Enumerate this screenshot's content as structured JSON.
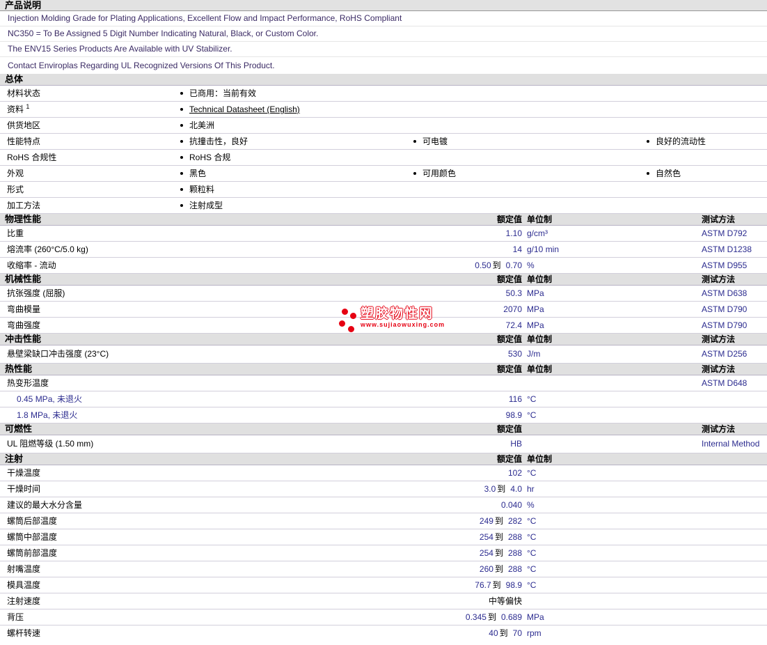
{
  "colors": {
    "value_text": "#2b2b8f",
    "description_text": "#3a2a64",
    "link": "#0000cc",
    "watermark_red": "#e60012",
    "section_bar_bg": "#e0e0e0"
  },
  "header": {
    "title": "产品说明"
  },
  "description": {
    "lines": [
      "Injection Molding Grade for Plating Applications, Excellent Flow and Impact Performance, RoHS Compliant",
      "NC350 = To Be Assigned 5 Digit Number Indicating Natural, Black, or Custom Color.",
      "The ENV15 Series Products Are Available with UV Stabilizer.",
      "Contact Enviroplas Regarding UL Recognized Versions Of This Product."
    ]
  },
  "general": {
    "title": "总体",
    "rows": [
      {
        "label": "材料状态",
        "items": [
          "已商用：当前有效"
        ]
      },
      {
        "label": "资料",
        "sup": "1",
        "items": [
          "Technical Datasheet (English)"
        ]
      },
      {
        "label": "供货地区",
        "items": [
          "北美洲"
        ]
      },
      {
        "label": "性能特点",
        "items": [
          "抗撞击性，良好",
          "可电镀",
          "良好的流动性"
        ]
      },
      {
        "label": "RoHS 合规性",
        "items": [
          "RoHS 合规"
        ]
      },
      {
        "label": "外观",
        "items": [
          "黑色",
          "可用颜色",
          "自然色"
        ]
      },
      {
        "label": "形式",
        "items": [
          "颗粒料"
        ]
      },
      {
        "label": "加工方法",
        "items": [
          "注射成型"
        ]
      }
    ]
  },
  "sections": [
    {
      "title": "物理性能",
      "col_value": "额定值",
      "col_unit": "单位制",
      "col_method": "测试方法",
      "rows": [
        {
          "label": "比重",
          "v1": "1.10",
          "unit": "g/cm³",
          "method": "ASTM D792"
        },
        {
          "label": "熔流率 (260°C/5.0 kg)",
          "v1": "14",
          "unit": "g/10 min",
          "method": "ASTM D1238"
        },
        {
          "label": "收缩率 - 流动",
          "v1": "0.50",
          "to": "到",
          "v2": "0.70",
          "unit": "%",
          "method": "ASTM D955"
        }
      ]
    },
    {
      "title": "机械性能",
      "col_value": "额定值",
      "col_unit": "单位制",
      "col_method": "测试方法",
      "rows": [
        {
          "label": "抗张强度 (屈服)",
          "v1": "50.3",
          "unit": "MPa",
          "method": "ASTM D638"
        },
        {
          "label": "弯曲模量",
          "v1": "2070",
          "unit": "MPa",
          "method": "ASTM D790"
        },
        {
          "label": "弯曲强度",
          "v1": "72.4",
          "unit": "MPa",
          "method": "ASTM D790"
        }
      ]
    },
    {
      "title": "冲击性能",
      "col_value": "额定值",
      "col_unit": "单位制",
      "col_method": "测试方法",
      "rows": [
        {
          "label": "悬壁梁缺口冲击强度 (23°C)",
          "v1": "530",
          "unit": "J/m",
          "method": "ASTM D256"
        }
      ]
    },
    {
      "title": "热性能",
      "col_value": "额定值",
      "col_unit": "单位制",
      "col_method": "测试方法",
      "rows": [
        {
          "label": "热变形温度",
          "method": "ASTM D648"
        },
        {
          "label": "0.45 MPa, 未退火",
          "v1": "116",
          "unit": "°C"
        },
        {
          "label": "1.8 MPa, 未退火",
          "v1": "98.9",
          "unit": "°C"
        }
      ]
    },
    {
      "title": "可燃性",
      "col_value": "额定值",
      "col_method": "测试方法",
      "rows": [
        {
          "label": "UL 阻燃等级 (1.50 mm)",
          "v1": "HB",
          "method": "Internal Method"
        }
      ]
    },
    {
      "title": "注射",
      "col_value": "额定值",
      "col_unit": "单位制",
      "rows": [
        {
          "label": "干燥温度",
          "v1": "102",
          "unit": "°C"
        },
        {
          "label": "干燥时间",
          "v1": "3.0",
          "to": "到",
          "v2": "4.0",
          "unit": "hr"
        },
        {
          "label": "建议的最大水分含量",
          "v1": "0.040",
          "unit": "%"
        },
        {
          "label": "螺筒后部温度",
          "v1": "249",
          "to": "到",
          "v2": "282",
          "unit": "°C"
        },
        {
          "label": "螺筒中部温度",
          "v1": "254",
          "to": "到",
          "v2": "288",
          "unit": "°C"
        },
        {
          "label": "螺筒前部温度",
          "v1": "254",
          "to": "到",
          "v2": "288",
          "unit": "°C"
        },
        {
          "label": "射嘴温度",
          "v1": "260",
          "to": "到",
          "v2": "288",
          "unit": "°C"
        },
        {
          "label": "模具温度",
          "v1": "76.7",
          "to": "到",
          "v2": "98.9",
          "unit": "°C"
        },
        {
          "label": "注射速度",
          "tv": "中等偏快"
        },
        {
          "label": "背压",
          "v1": "0.345",
          "to": "到",
          "v2": "0.689",
          "unit": "MPa"
        },
        {
          "label": "螺杆转速",
          "v1": "40",
          "to": "到",
          "v2": "70",
          "unit": "rpm"
        }
      ]
    }
  ],
  "watermark": {
    "name": "塑胶物性网",
    "url": "www.sujiaowuxing.com"
  }
}
